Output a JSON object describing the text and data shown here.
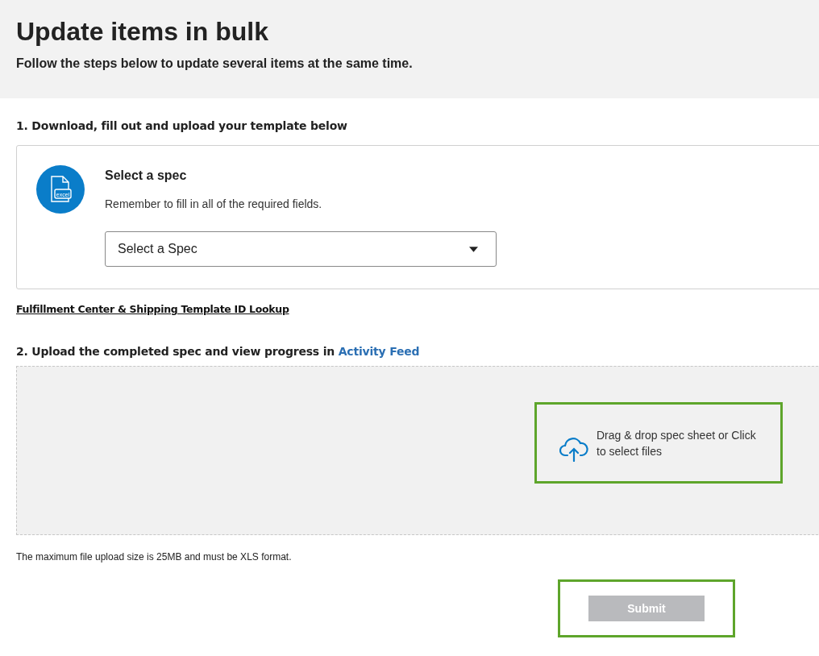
{
  "header": {
    "title": "Update items in bulk",
    "subtitle": "Follow the steps below to update several items at the same time."
  },
  "step1": {
    "heading": "1. Download, fill out and upload your template below",
    "card": {
      "icon_label": "excel",
      "title": "Select a spec",
      "description": "Remember to fill in all of the required fields.",
      "select": {
        "value": "Select a Spec"
      }
    },
    "link": "Fulfillment Center & Shipping Template ID Lookup"
  },
  "step2": {
    "heading": "2. Upload the completed spec and view progress in",
    "heading_link": "Activity Feed",
    "dropzone": {
      "text": "Drag & drop spec sheet or Click to select files",
      "highlighted": true
    }
  },
  "note": "The maximum file upload size is 25MB and must be XLS format.",
  "submit": {
    "label": "Submit",
    "disabled": true,
    "highlighted": true
  }
}
